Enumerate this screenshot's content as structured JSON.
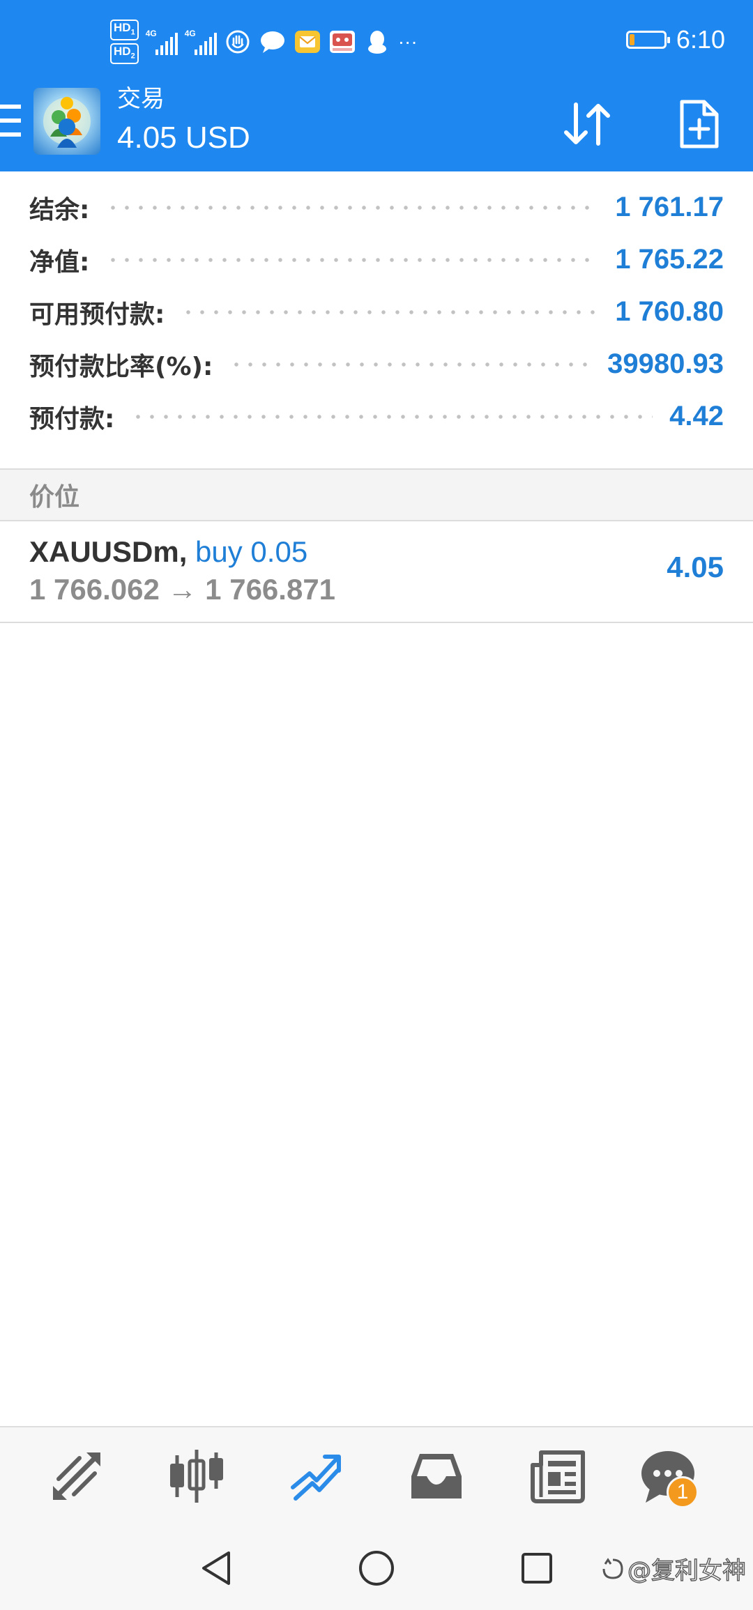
{
  "status_bar": {
    "sim1_label": "HD",
    "sim1_index": "1",
    "sim2_label": "HD",
    "sim2_index": "2",
    "net1": "4G",
    "net2": "4G",
    "notification_icons": [
      "hand-icon",
      "chat-bubble-icon",
      "mail-icon",
      "app-icon",
      "qq-penguin-icon"
    ],
    "more": "···",
    "battery_level": 0.15,
    "time": "6:10"
  },
  "header": {
    "title": "交易",
    "subtitle": "4.05 USD",
    "actions": [
      "sort-icon",
      "new-order-icon"
    ]
  },
  "summary": [
    {
      "label": "结余:",
      "value": "1 761.17"
    },
    {
      "label": "净值:",
      "value": "1 765.22"
    },
    {
      "label": "可用预付款:",
      "value": "1 760.80"
    },
    {
      "label": "预付款比率(%):",
      "value": "39980.93"
    },
    {
      "label": "预付款:",
      "value": "4.42"
    }
  ],
  "section_title": "价位",
  "position": {
    "symbol": "XAUUSDm",
    "separator": ",",
    "side": "buy 0.05",
    "price_line": "1 766.062 → 1 766.871",
    "profit": "4.05"
  },
  "tabs": [
    {
      "name": "quotes-tab",
      "icon": "arrows-icon"
    },
    {
      "name": "chart-tab",
      "icon": "candlestick-icon"
    },
    {
      "name": "trade-tab",
      "icon": "trend-icon",
      "active": true
    },
    {
      "name": "history-tab",
      "icon": "inbox-icon"
    },
    {
      "name": "news-tab",
      "icon": "newspaper-icon"
    },
    {
      "name": "messages-tab",
      "icon": "chat-icon",
      "badge": "1"
    }
  ],
  "nav": [
    "back-icon",
    "home-icon",
    "recents-icon"
  ],
  "watermark": "@复利女神",
  "colors": {
    "primary": "#1e88f0",
    "value_blue": "#1f7ed6",
    "label_dark": "#333333",
    "muted_gray": "#8c8c8c",
    "badge_orange": "#f39a1e"
  }
}
